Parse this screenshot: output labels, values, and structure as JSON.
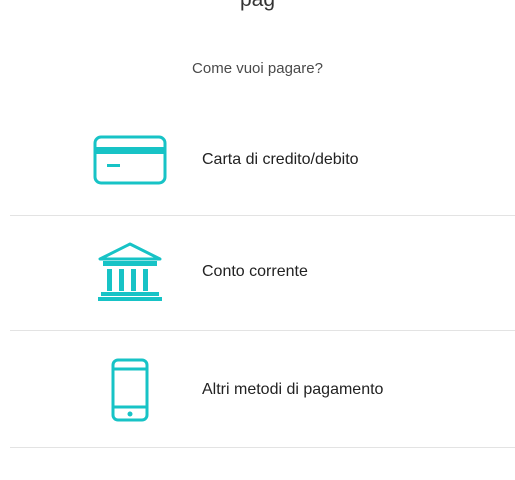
{
  "header": {
    "partial_text": "pag",
    "question": "Come vuoi pagare?"
  },
  "options": [
    {
      "label": "Carta di credito/debito",
      "icon": "credit-card-icon"
    },
    {
      "label": "Conto corrente",
      "icon": "bank-icon"
    },
    {
      "label": "Altri metodi di pagamento",
      "icon": "smartphone-icon"
    }
  ],
  "colors": {
    "accent": "#17c3c6",
    "divider": "#e3e3e3",
    "text": "#222222"
  }
}
